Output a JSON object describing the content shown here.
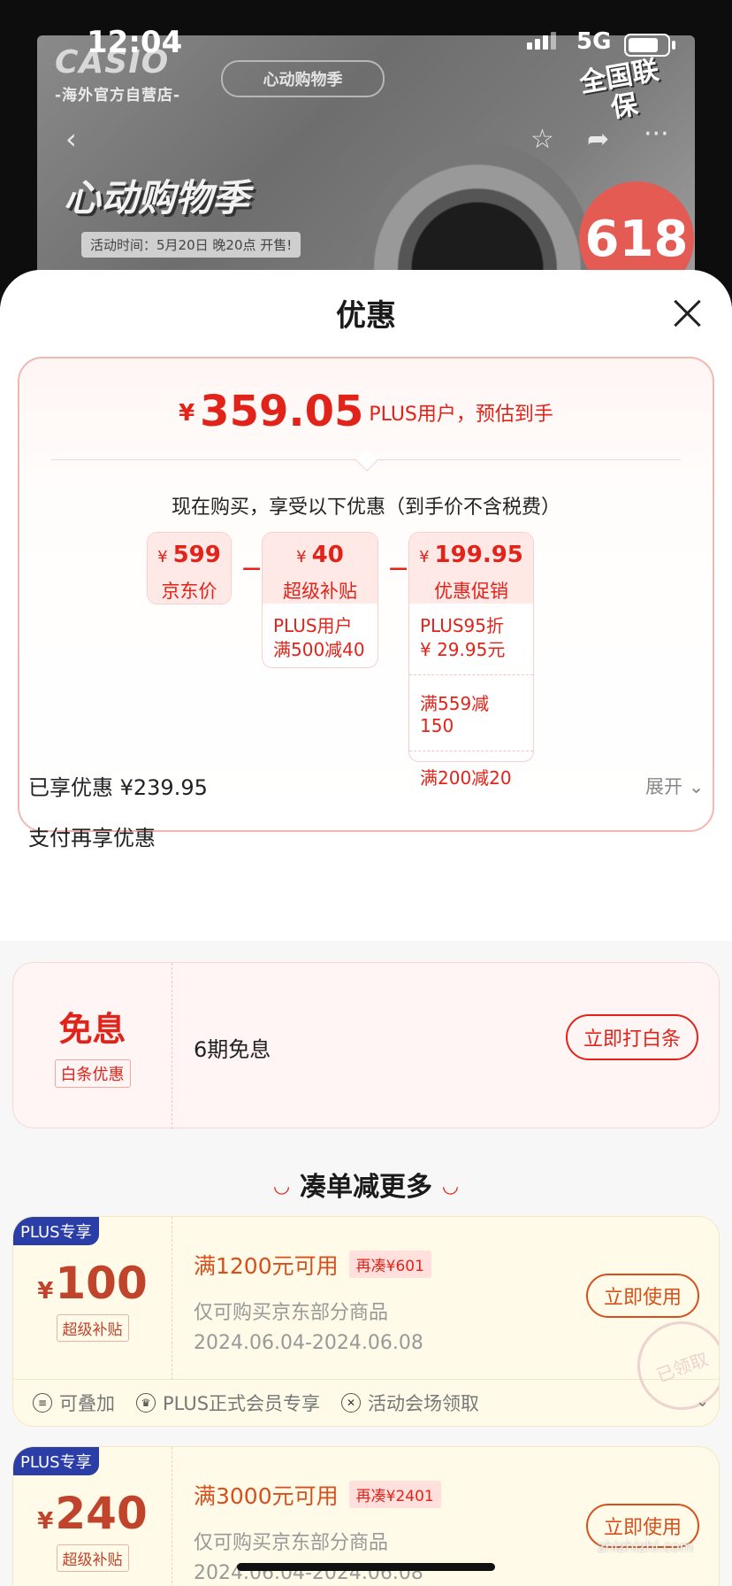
{
  "status_bar": {
    "time": "12:04",
    "network": "5G"
  },
  "banner": {
    "brand_logo": "CASIO",
    "brand_sub": "-海外官方自营店-",
    "event_tag": "心动购物季",
    "headline": "心动购物季",
    "time_label": "活动时间：5月20日 晚20点 开售!",
    "warranty": "全国联保",
    "badge": "618"
  },
  "sheet": {
    "title": "优惠",
    "final_price": {
      "currency": "¥",
      "amount": "359.05",
      "note": "PLUS用户，预估到手"
    },
    "buy_note": "现在购买，享受以下优惠（到手价不含税费）",
    "jd_price": {
      "value": "599",
      "label": "京东价"
    },
    "subsidy": {
      "value": "40",
      "label": "超级补贴",
      "detail_1": "PLUS用户",
      "detail_2": "满500减40"
    },
    "promo": {
      "value": "199.95",
      "label": "优惠促销",
      "detail_1": "PLUS95折",
      "detail_2": "¥ 29.95元",
      "row_2": "满559减150",
      "row_3": "满200减20"
    },
    "minus": "−",
    "currency": "¥",
    "saved": "已享优惠 ¥239.95",
    "expand": "展开",
    "pay_title": "支付再享优惠"
  },
  "credit": {
    "big": "免息",
    "tag": "白条优惠",
    "text": "6期免息",
    "button": "立即打白条"
  },
  "section_title": "凑单减更多",
  "coupons": [
    {
      "plus_tag": "PLUS专享",
      "currency": "¥",
      "amount": "100",
      "tag": "超级补贴",
      "condition": "满1200元可用",
      "extra": "再凑¥601",
      "desc": "仅可购买京东部分商品",
      "date": "2024.06.04-2024.06.08",
      "button": "立即使用",
      "stamp": "已领取"
    },
    {
      "plus_tag": "PLUS专享",
      "currency": "¥",
      "amount": "240",
      "tag": "超级补贴",
      "condition": "满3000元可用",
      "extra": "再凑¥2401",
      "desc": "仅可购买京东部分商品",
      "date": "2024.06.04-2024.06.08",
      "button": "立即使用"
    }
  ],
  "coupon_meta": {
    "stackable": "可叠加",
    "member": "PLUS正式会员专享",
    "venue": "活动会场领取"
  },
  "watermark": "zhizhizhi.com"
}
